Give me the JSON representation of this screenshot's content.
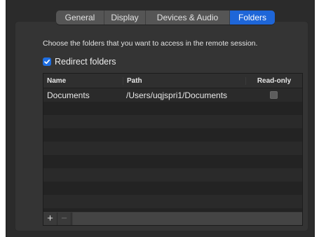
{
  "tabs": [
    {
      "label": "General",
      "active": false
    },
    {
      "label": "Display",
      "active": false
    },
    {
      "label": "Devices & Audio",
      "active": false
    },
    {
      "label": "Folders",
      "active": true
    }
  ],
  "description": "Choose the folders that you want to access in the remote session.",
  "redirect": {
    "label": "Redirect folders",
    "checked": true
  },
  "table": {
    "columns": [
      "Name",
      "Path",
      "Read-only"
    ],
    "rows": [
      {
        "name": "Documents",
        "path": "/Users/uqjspri1/Documents",
        "read_only": false
      }
    ]
  },
  "footer": {
    "add_label": "+",
    "remove_label": "−"
  },
  "colors": {
    "accent": "#1e66d8"
  }
}
